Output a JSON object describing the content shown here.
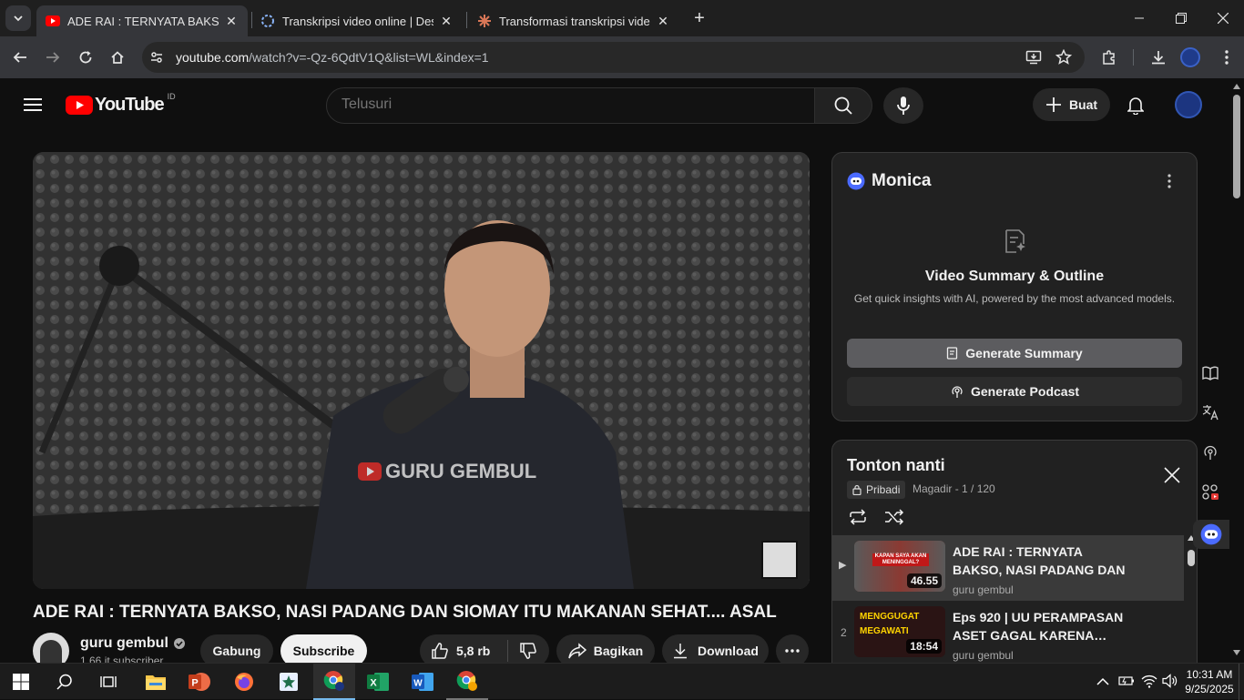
{
  "browser": {
    "tabs": [
      {
        "title": "ADE RAI : TERNYATA BAKSO, NASI PADANG DAN SIOMAY ITU MAKANAN SEHAT",
        "active": true
      },
      {
        "title": "Transkripsi video online | Desgra",
        "active": false
      },
      {
        "title": "Transformasi transkripsi video menjadi",
        "active": false
      }
    ],
    "url_host": "youtube.com",
    "url_path": "/watch?v=-Qz-6QdtV1Q&list=WL&index=1"
  },
  "youtube": {
    "logo_text": "YouTube",
    "region": "ID",
    "search_placeholder": "Telusuri",
    "create_label": "Buat"
  },
  "video": {
    "watermark": "GURU GEMBUL",
    "title": "ADE RAI : TERNYATA BAKSO, NASI PADANG DAN SIOMAY ITU MAKANAN SEHAT.... ASAL",
    "channel": "guru gembul",
    "subscribers": "1,66 jt subscriber",
    "join_label": "Gabung",
    "subscribe_label": "Subscribe",
    "likes": "5,8 rb",
    "share_label": "Bagikan",
    "download_label": "Download"
  },
  "monica": {
    "name": "Monica",
    "heading": "Video Summary & Outline",
    "subtitle": "Get quick insights with AI, powered by the most advanced models.",
    "summary_button": "Generate Summary",
    "podcast_button": "Generate Podcast"
  },
  "playlist": {
    "title": "Tonton nanti",
    "privacy": "Pribadi",
    "meta": "Magadir - 1 / 120",
    "items": [
      {
        "index": "▶",
        "title": "ADE RAI : TERNYATA BAKSO, NASI PADANG DAN SIOMAY…",
        "channel": "guru gembul",
        "duration": "46.55",
        "thumb_text": "KAPAN SAYA AKAN MENINGGAL?"
      },
      {
        "index": "2",
        "title": "Eps 920 | UU PERAMPASAN ASET GAGAL KARENA…",
        "channel": "guru gembul",
        "duration": "18:54",
        "thumb_text": "MENGGUGAT MEGAWATI"
      }
    ]
  },
  "taskbar": {
    "time": "10:31 AM",
    "date": "9/25/2025"
  },
  "colors": {
    "youtube_red": "#ff0000",
    "accent_blue": "#3ea6ff",
    "chrome_bg": "#35363a"
  }
}
